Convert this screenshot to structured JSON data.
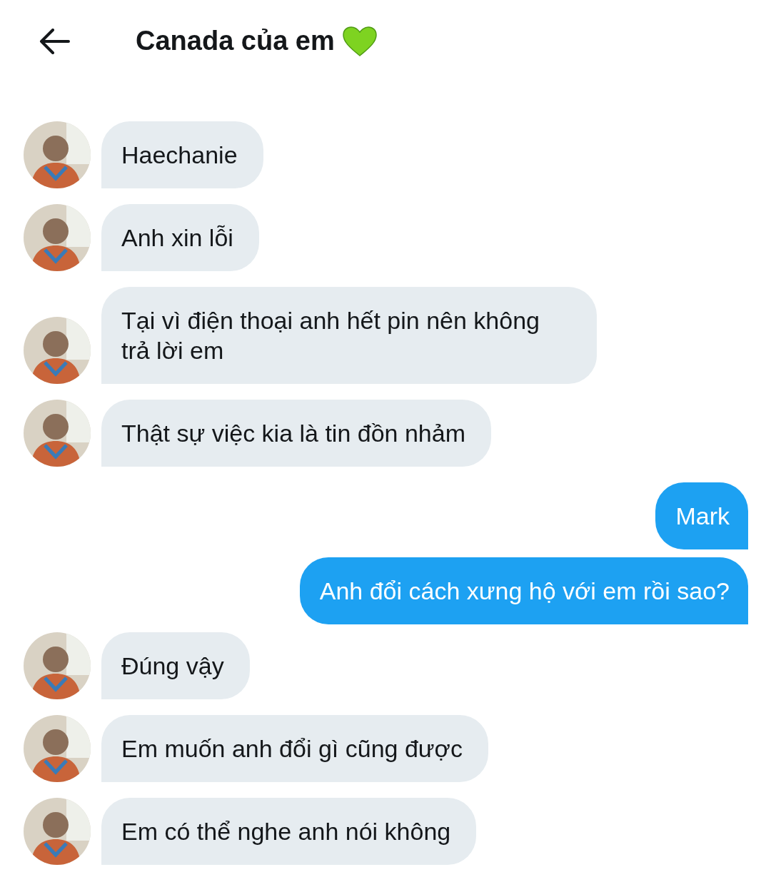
{
  "header": {
    "title": "Canada của em"
  },
  "messages": [
    {
      "kind": "incoming",
      "text": "Haechanie"
    },
    {
      "kind": "incoming",
      "text": "Anh xin lỗi"
    },
    {
      "kind": "incoming",
      "text": "Tại vì điện thoại anh hết pin nên không trả lời em"
    },
    {
      "kind": "incoming",
      "text": "Thật sự việc kia là tin đồn nhảm"
    },
    {
      "kind": "outgoing",
      "text": "Mark"
    },
    {
      "kind": "outgoing",
      "text": "Anh đổi cách xưng hộ với em rồi sao?"
    },
    {
      "kind": "incoming",
      "text": "Đúng vậy"
    },
    {
      "kind": "incoming",
      "text": "Em muốn anh đổi gì cũng được"
    },
    {
      "kind": "incoming",
      "text": "Em có thể nghe anh nói không"
    }
  ]
}
